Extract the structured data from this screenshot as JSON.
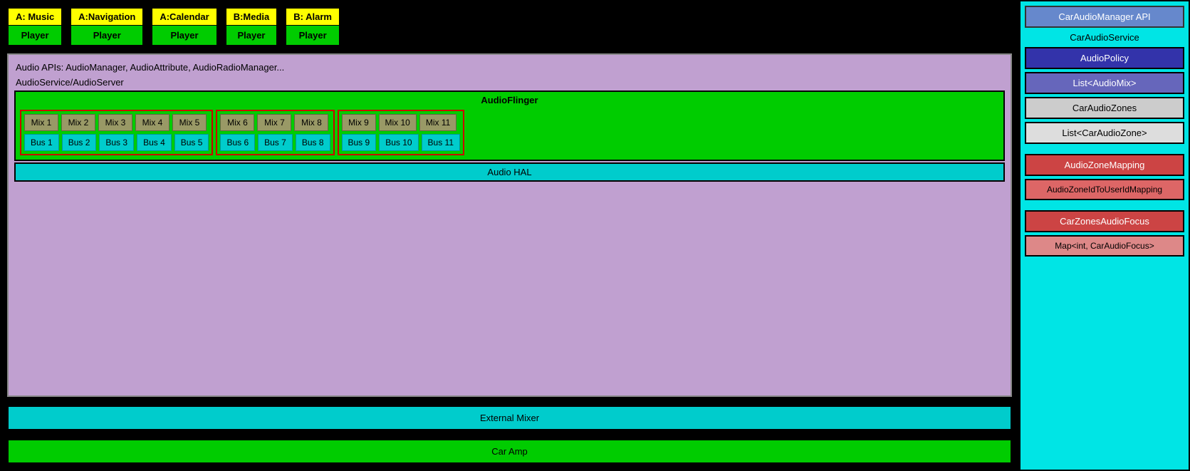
{
  "players": [
    {
      "label": "A: Music",
      "body": "Player"
    },
    {
      "label": "A:Navigation",
      "body": "Player"
    },
    {
      "label": "A:Calendar",
      "body": "Player"
    },
    {
      "label": "B:Media",
      "body": "Player"
    },
    {
      "label": "B: Alarm",
      "body": "Player"
    }
  ],
  "audio_apis_label": "Audio APIs: AudioManager, AudioAttribute, AudioRadioManager...",
  "audio_service_label": "AudioService/AudioServer",
  "audio_flinger_label": "AudioFlinger",
  "zones": [
    {
      "mixes": [
        "Mix 1",
        "Mix 2",
        "Mix 3",
        "Mix 4",
        "Mix 5"
      ],
      "buses": [
        "Bus 1",
        "Bus 2",
        "Bus 3",
        "Bus 4",
        "Bus 5"
      ]
    },
    {
      "mixes": [
        "Mix 6",
        "Mix 7",
        "Mix 8"
      ],
      "buses": [
        "Bus 6",
        "Bus 7",
        "Bus 8"
      ]
    },
    {
      "mixes": [
        "Mix 9",
        "Mix 10",
        "Mix 11"
      ],
      "buses": [
        "Bus 9",
        "Bus 10",
        "Bus 11"
      ]
    }
  ],
  "audio_hal_label": "Audio HAL",
  "external_mixer_label": "External Mixer",
  "car_amp_label": "Car Amp",
  "right_panel": {
    "car_audio_manager_api": "CarAudioManager API",
    "car_audio_service": "CarAudioService",
    "audio_policy": "AudioPolicy",
    "list_audio_mix": "List<AudioMix>",
    "car_audio_zones": "CarAudioZones",
    "list_car_audio_zone": "List<CarAudioZone>",
    "audio_zone_mapping": "AudioZoneMapping",
    "audio_zone_id_mapping": "AudioZoneIdToUserIdMapping",
    "car_zones_audio_focus": "CarZonesAudioFocus",
    "map_car_audio_focus": "Map<int, CarAudioFocus>"
  }
}
